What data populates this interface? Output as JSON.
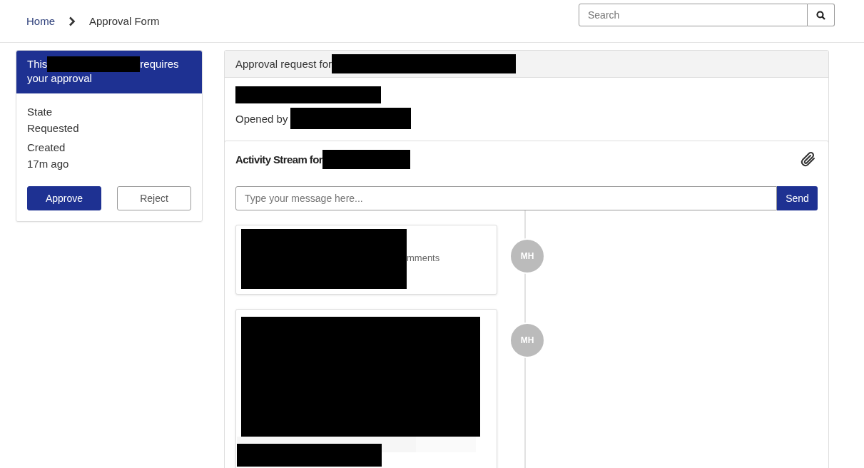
{
  "breadcrumb": [
    {
      "label": "Home",
      "link": true
    },
    {
      "label": "Approval Form",
      "link": false
    }
  ],
  "search": {
    "placeholder": "Search"
  },
  "approval_card": {
    "title_start": "This",
    "title_end": [
      "requires",
      "your approval"
    ],
    "fields": [
      {
        "label": "State",
        "value": "Requested"
      },
      {
        "label": "Created",
        "value": "17m ago"
      }
    ],
    "buttons": [
      {
        "label": "Approve",
        "kind": "primary"
      },
      {
        "label": "Reject",
        "kind": "secondary"
      }
    ]
  },
  "request": {
    "header": "Approval request for",
    "opened_by": "Opened by"
  },
  "activity": {
    "title": "Activity Stream for",
    "message": {
      "placeholder": "Type your message here..."
    },
    "send": "Send",
    "entries": [
      {
        "kind": "text",
        "initials": "MH",
        "text": "mments"
      },
      {
        "kind": "image",
        "initials": "MH"
      }
    ]
  }
}
